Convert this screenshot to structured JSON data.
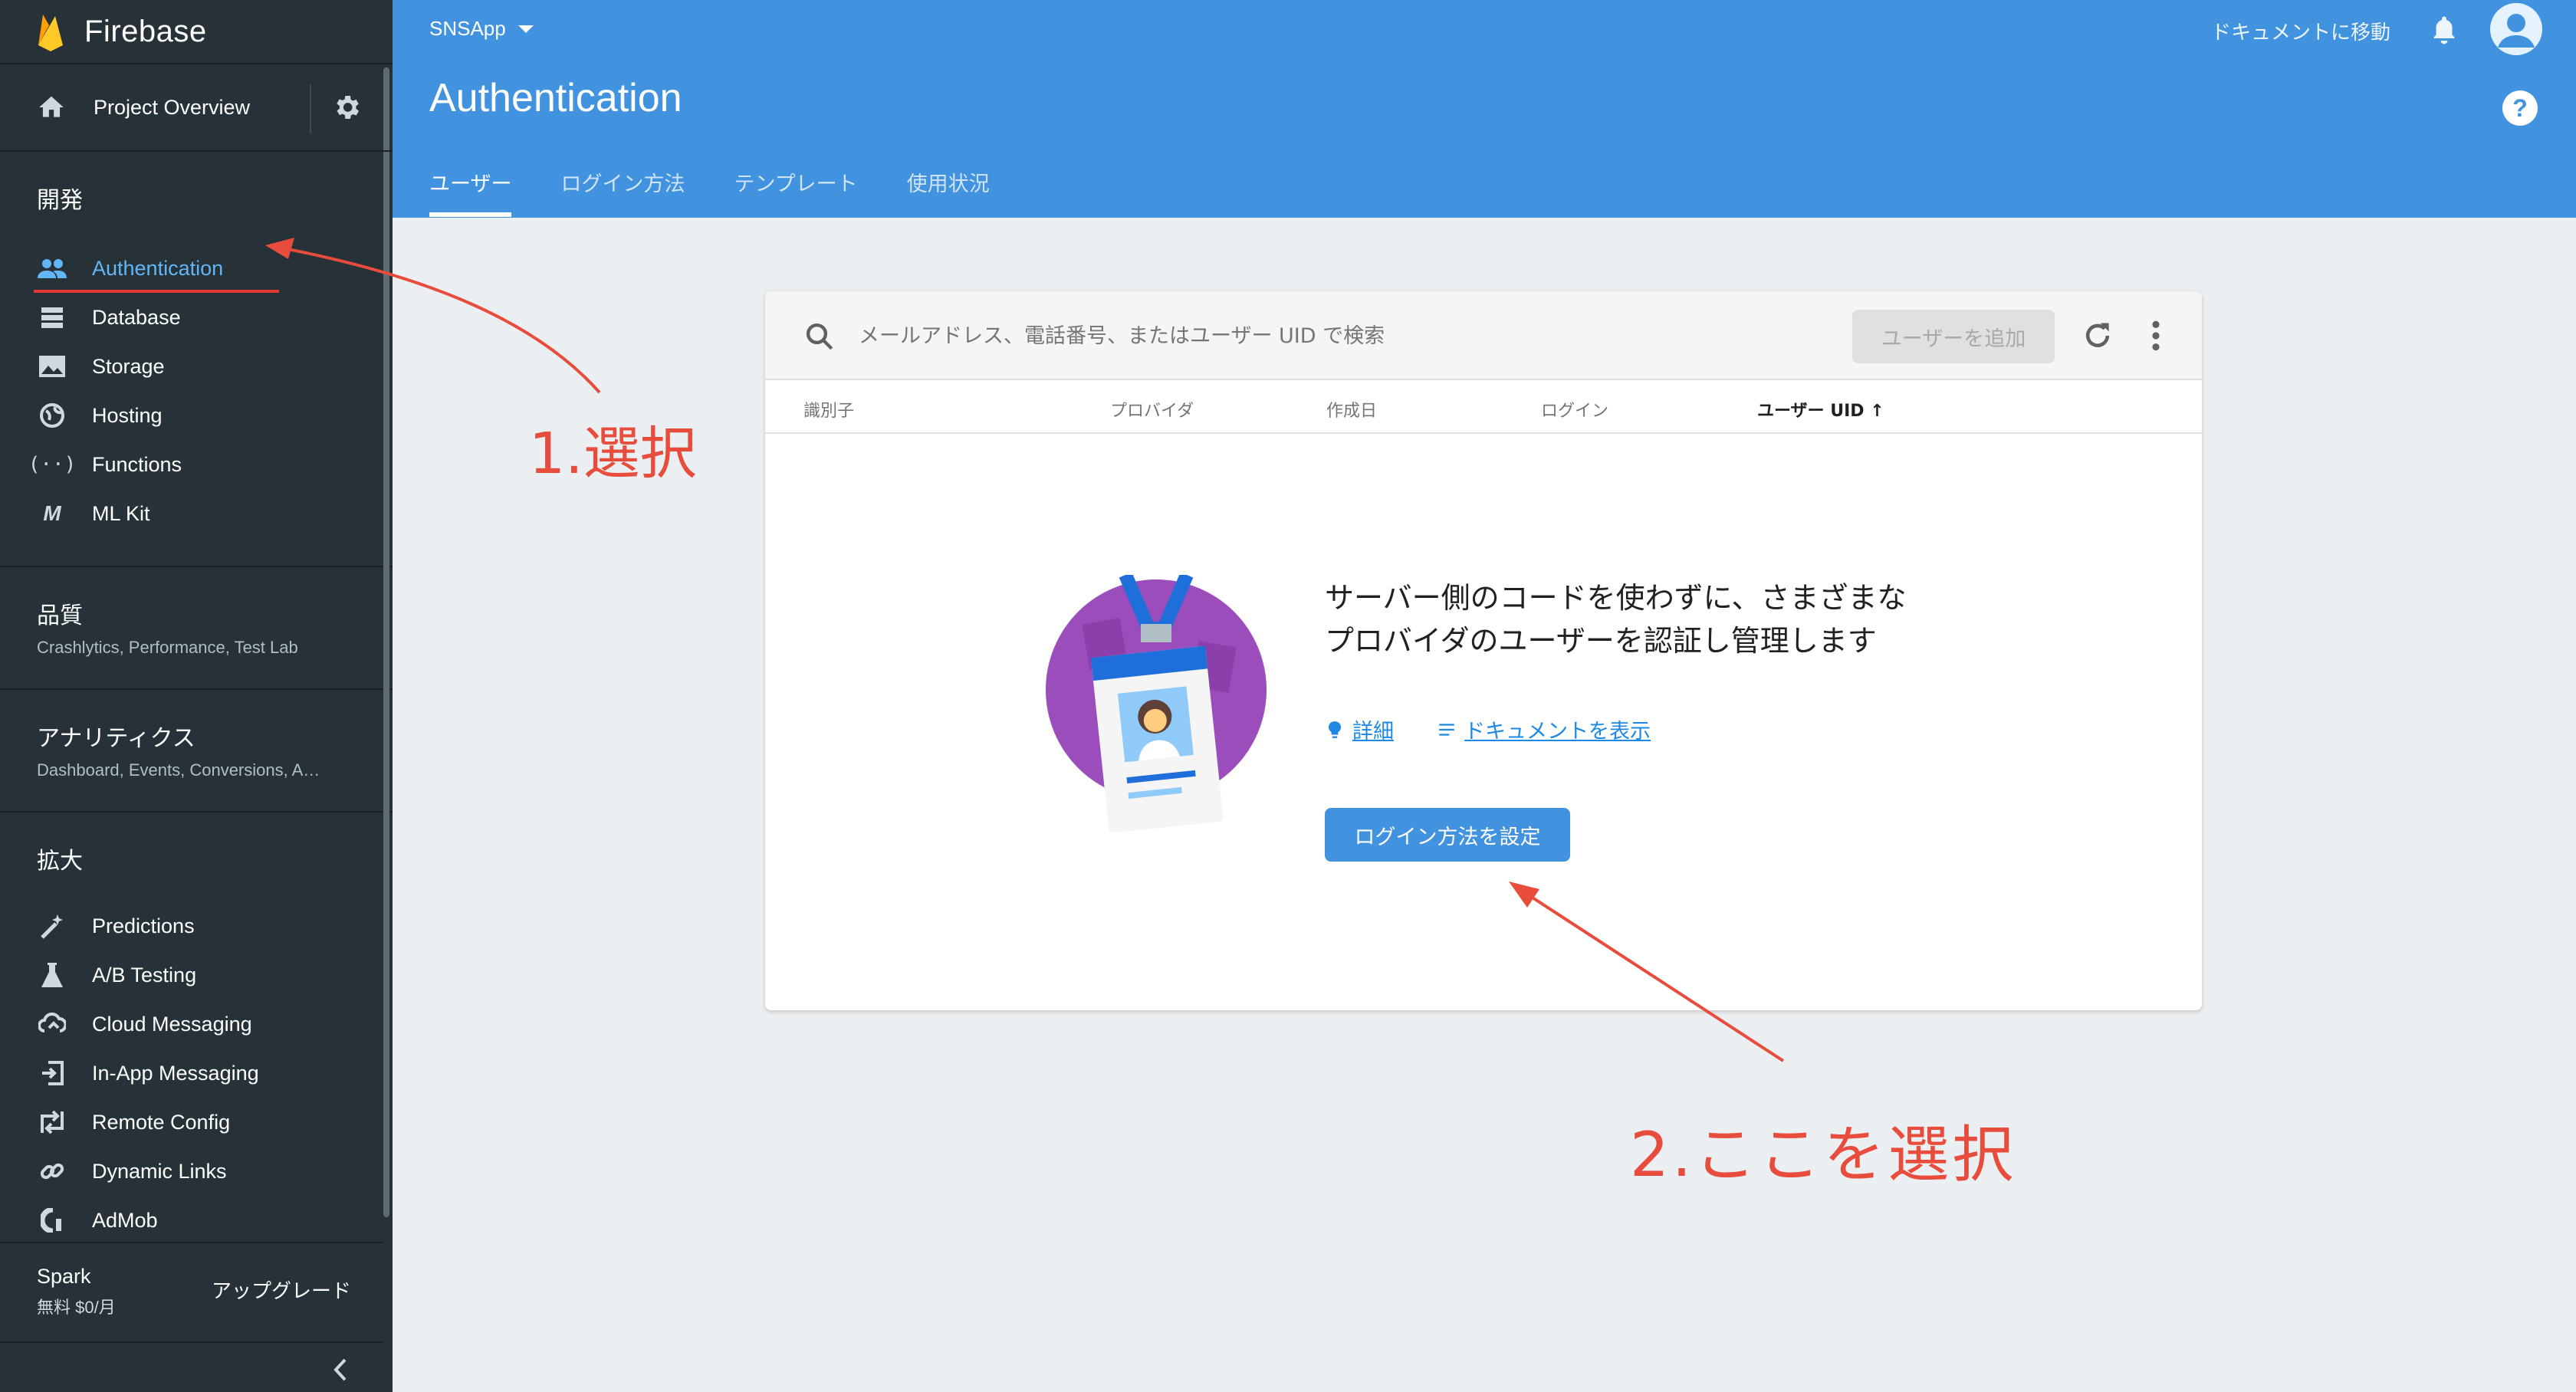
{
  "sidebar": {
    "brand": "Firebase",
    "project_overview": "Project Overview",
    "develop_title": "開発",
    "develop_items": [
      {
        "label": "Authentication",
        "icon": "people-icon"
      },
      {
        "label": "Database",
        "icon": "database-icon"
      },
      {
        "label": "Storage",
        "icon": "image-icon"
      },
      {
        "label": "Hosting",
        "icon": "globe-icon"
      },
      {
        "label": "Functions",
        "icon": "functions-icon"
      },
      {
        "label": "ML Kit",
        "icon": "ml-kit-icon"
      }
    ],
    "quality_title": "品質",
    "quality_sub": "Crashlytics, Performance, Test Lab",
    "analytics_title": "アナリティクス",
    "analytics_sub": "Dashboard, Events, Conversions, A…",
    "grow_title": "拡大",
    "grow_items": [
      {
        "label": "Predictions",
        "icon": "wand-icon"
      },
      {
        "label": "A/B Testing",
        "icon": "flask-icon"
      },
      {
        "label": "Cloud Messaging",
        "icon": "cloud-icon"
      },
      {
        "label": "In-App Messaging",
        "icon": "in-app-icon"
      },
      {
        "label": "Remote Config",
        "icon": "remote-config-icon"
      },
      {
        "label": "Dynamic Links",
        "icon": "link-icon"
      },
      {
        "label": "AdMob",
        "icon": "admob-icon"
      }
    ],
    "plan_name": "Spark",
    "plan_price": "無料 $0/月",
    "upgrade": "アップグレード"
  },
  "header": {
    "project": "SNSApp",
    "title": "Authentication",
    "docs_link": "ドキュメントに移動",
    "help": "?",
    "tabs": [
      "ユーザー",
      "ログイン方法",
      "テンプレート",
      "使用状況"
    ]
  },
  "card": {
    "search_placeholder": "メールアドレス、電話番号、またはユーザー UID で検索",
    "add_user": "ユーザーを追加",
    "columns": [
      "識別子",
      "プロバイダ",
      "作成日",
      "ログイン",
      "ユーザー UID"
    ],
    "empty_text": "サーバー側のコードを使わずに、さまざまなプロバイダのユーザーを認証し管理します",
    "link_details": "詳細",
    "link_docs": "ドキュメントを表示",
    "setup_button": "ログイン方法を設定"
  },
  "annotations": {
    "step1": "1.選択",
    "step2": "2.ここを選択"
  },
  "colors": {
    "header_bg": "#4192df",
    "sidebar_bg": "#263238",
    "active_nav": "#64b5f6",
    "annotation": "#e74c3c"
  }
}
